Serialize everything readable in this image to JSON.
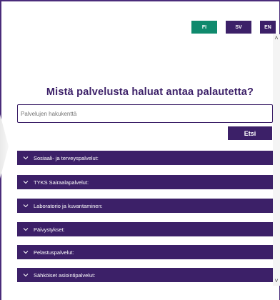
{
  "languages": [
    {
      "code": "FI"
    },
    {
      "code": "SV"
    },
    {
      "code": "EN"
    }
  ],
  "heading": "Mistä palvelusta haluat antaa palautetta?",
  "search": {
    "placeholder": "Palvelujen hakukenttä",
    "button_label": "Etsi"
  },
  "services": [
    {
      "label": "Sosiaali- ja terveyspalvelut:"
    },
    {
      "label": "TYKS Sairaalapalvelut:"
    },
    {
      "label": "Laboratorio ja kuvantaminen:"
    },
    {
      "label": "Päivystykset:"
    },
    {
      "label": "Pelastuspalvelut:"
    },
    {
      "label": "Sähköiset asiointipalvelut:"
    }
  ],
  "colors": {
    "brand_purple": "#3c2068",
    "accent_green": "#0f8a6d"
  }
}
